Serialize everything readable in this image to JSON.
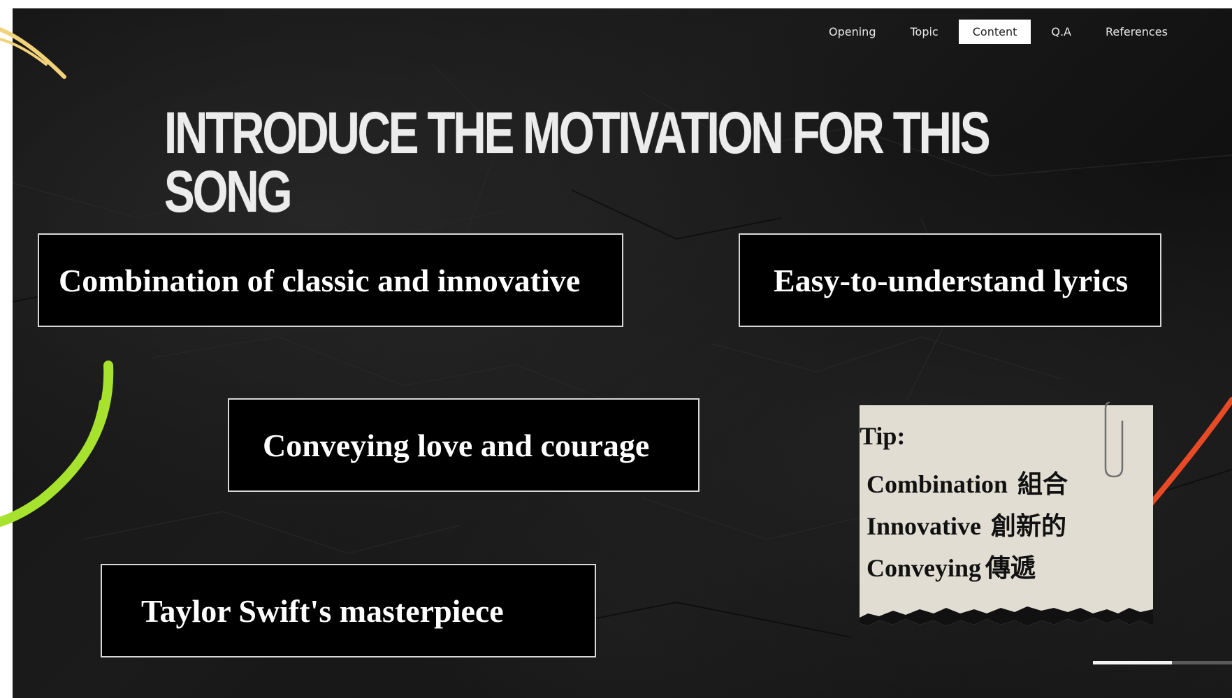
{
  "nav": {
    "items": [
      {
        "label": "Opening",
        "active": false
      },
      {
        "label": "Topic",
        "active": false
      },
      {
        "label": "Content",
        "active": true
      },
      {
        "label": "Q.A",
        "active": false
      },
      {
        "label": "References",
        "active": false
      }
    ]
  },
  "slide": {
    "title": "INTRODUCE THE MOTIVATION FOR THIS SONG",
    "boxes": [
      "Combination of classic and innovative",
      "Easy-to-understand lyrics",
      "Conveying love and courage",
      "Taylor Swift's masterpiece"
    ]
  },
  "tip": {
    "heading": "Tip:",
    "entries": [
      {
        "en": "Combination",
        "zh": "組合"
      },
      {
        "en": "Innovative",
        "zh": "創新的"
      },
      {
        "en": "Conveying",
        "zh": "傳遞"
      }
    ],
    "icon": "paperclip-icon"
  },
  "progress": {
    "fraction": 0.57
  },
  "colors": {
    "background": "#141414",
    "box_border": "#d8d8d8",
    "note_paper": "#e2ddd3",
    "yellow_stroke": "#f1d27a",
    "green_stroke": "#a6e22e",
    "red_stroke": "#e84a26"
  }
}
